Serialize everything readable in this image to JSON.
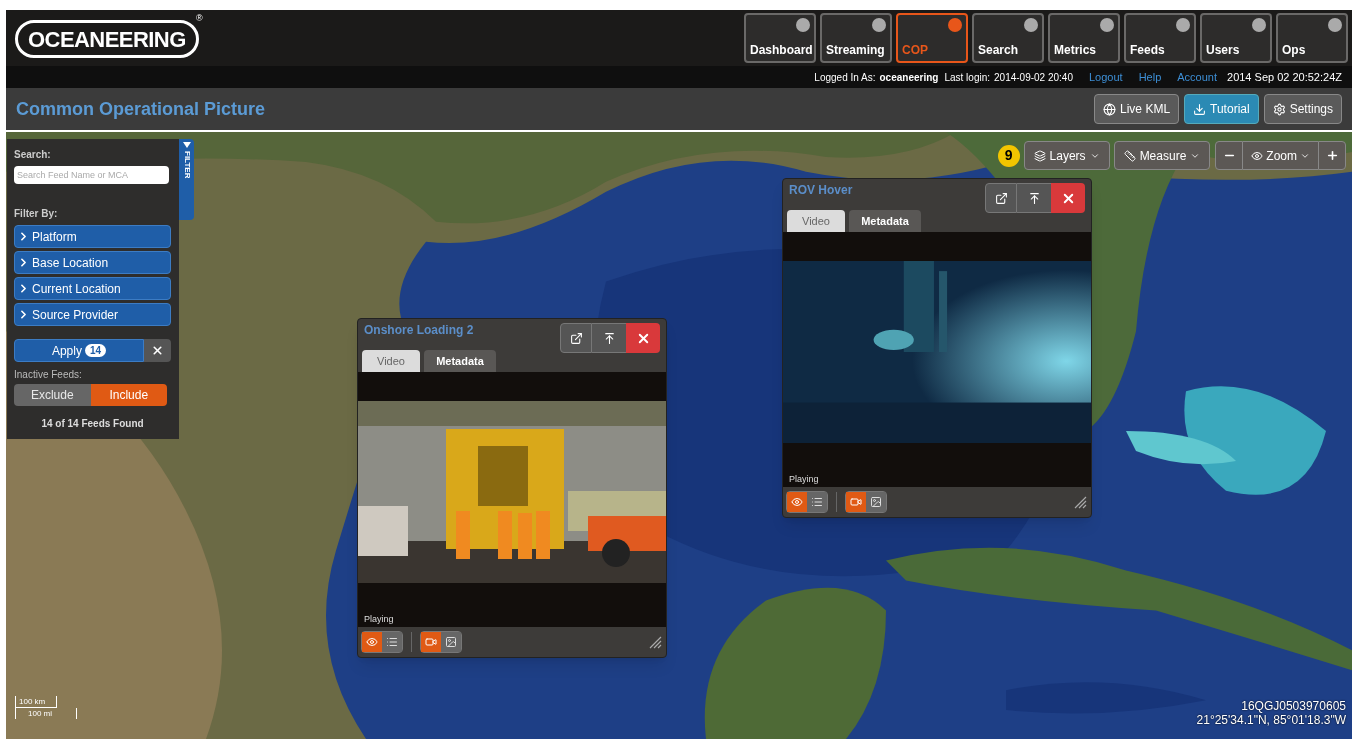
{
  "header": {
    "logo": "OCEANEERING",
    "registered": "®"
  },
  "nav": [
    {
      "label": "Dashboard",
      "selected": false
    },
    {
      "label": "Streaming",
      "selected": false
    },
    {
      "label": "COP",
      "selected": true
    },
    {
      "label": "Search",
      "selected": false
    },
    {
      "label": "Metrics",
      "selected": false
    },
    {
      "label": "Feeds",
      "selected": false
    },
    {
      "label": "Users",
      "selected": false
    },
    {
      "label": "Ops",
      "selected": false
    }
  ],
  "user_bar": {
    "logged_in_label": "Logged In As:",
    "user": "oceaneering",
    "last_login_label": "Last login:",
    "last_login": "2014-09-02 20:40",
    "links": [
      "Logout",
      "Help",
      "Account"
    ],
    "clock": "2014 Sep 02 20:52:24Z"
  },
  "page_title": "Common Operational Picture",
  "page_actions": [
    {
      "label": "Live KML",
      "kind": "default"
    },
    {
      "label": "Tutorial",
      "kind": "primary"
    },
    {
      "label": "Settings",
      "kind": "default"
    }
  ],
  "filter_panel": {
    "tab_label": "FILTER",
    "search_label": "Search:",
    "search_placeholder": "Search Feed Name or MCA",
    "filter_by_label": "Filter By:",
    "filters": [
      {
        "label": "Platform",
        "expanded": false
      },
      {
        "label": "Base Location",
        "expanded": false
      },
      {
        "label": "Current Location",
        "expanded": false
      },
      {
        "label": "Source Provider",
        "expanded": false
      }
    ],
    "apply": {
      "label": "Apply",
      "count": "14"
    },
    "inactive_label": "Inactive Feeds:",
    "inactive_options": [
      {
        "label": "Exclude",
        "selected": false
      },
      {
        "label": "Include",
        "selected": true
      }
    ],
    "result": "14 of 14 Feeds Found"
  },
  "map_toolbar": {
    "badge": "9",
    "menus": [
      "Layers",
      "Measure"
    ],
    "zoom_label": "Zoom"
  },
  "video_windows": [
    {
      "title": "Onshore Loading 2",
      "tabs": [
        {
          "label": "Video",
          "selected": true
        },
        {
          "label": "Metadata",
          "selected": false
        }
      ],
      "status": "Playing",
      "view_toggles": [
        {
          "selected": true
        },
        {
          "selected": false
        }
      ],
      "media_toggles": [
        {
          "selected": true
        },
        {
          "selected": false
        }
      ]
    },
    {
      "title": "ROV Hover",
      "tabs": [
        {
          "label": "Video",
          "selected": true
        },
        {
          "label": "Metadata",
          "selected": false
        }
      ],
      "status": "Playing",
      "view_toggles": [
        {
          "selected": true
        },
        {
          "selected": false
        }
      ],
      "media_toggles": [
        {
          "selected": true
        },
        {
          "selected": false
        }
      ]
    }
  ],
  "scale": [
    "100 km",
    "100 mi"
  ],
  "coordinates": {
    "grid": "16QGJ0503970605",
    "latlon": "21°25'34.1\"N, 85°01'18.3\"W"
  }
}
